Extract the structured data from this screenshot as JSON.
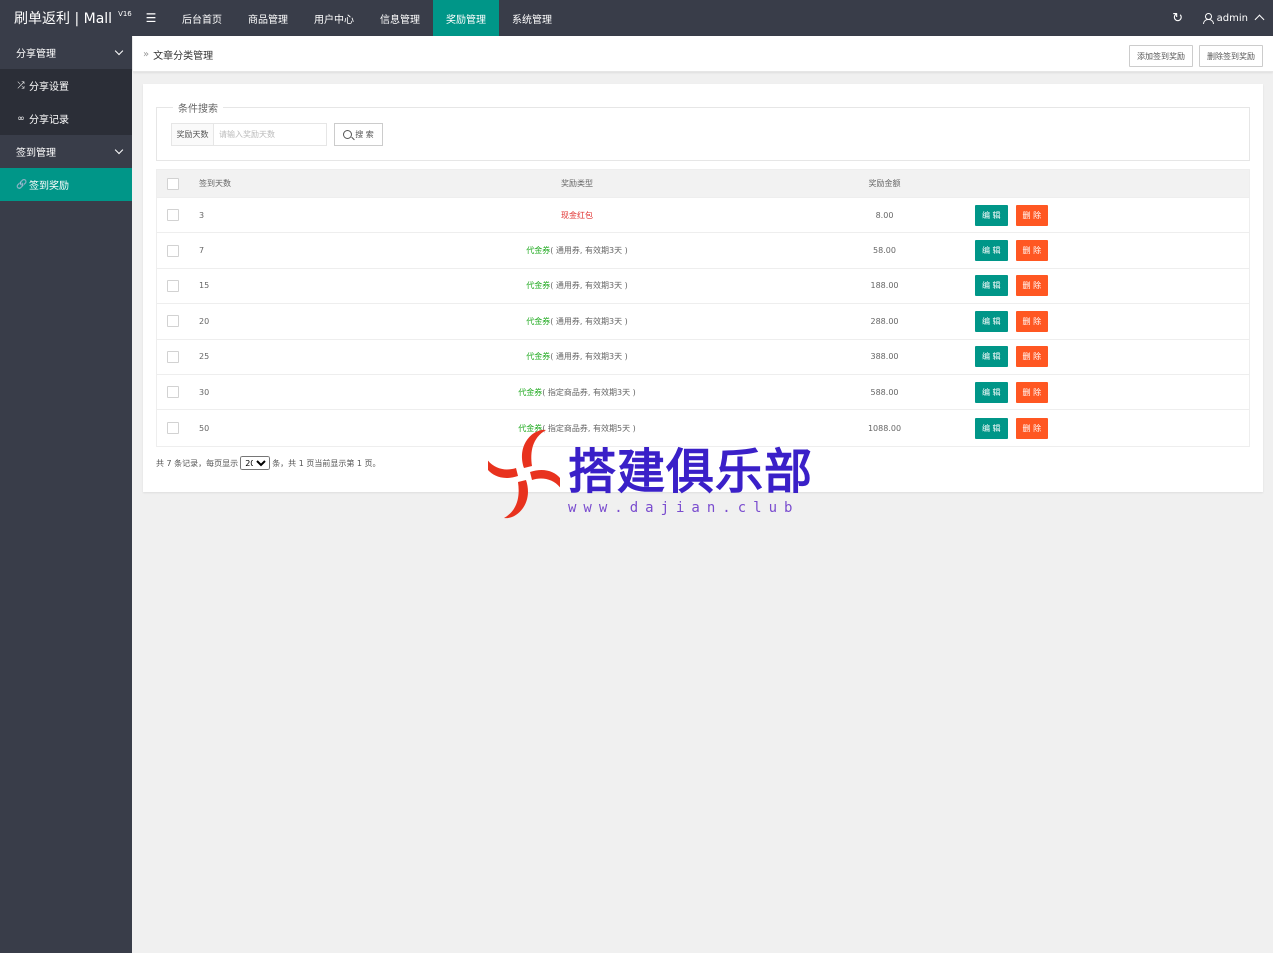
{
  "header": {
    "logo_text": "刷单返利 | Mall",
    "logo_version": "V16",
    "nav_toggle_icon": "menu-icon",
    "nav": [
      "后台首页",
      "商品管理",
      "用户中心",
      "信息管理",
      "奖励管理",
      "系统管理"
    ],
    "active_nav": "奖励管理",
    "user": "admin"
  },
  "sidebar": {
    "group1": "分享管理",
    "item_share_settings": "分享设置",
    "item_share_records": "分享记录",
    "group2": "签到管理",
    "item_sign_rewards": "签到奖励"
  },
  "breadcrumb": {
    "arrow": "»",
    "title": "文章分类管理",
    "add_button": "添加签到奖励",
    "delete_button": "删除签到奖励"
  },
  "search": {
    "legend": "条件搜索",
    "label": "奖励天数",
    "placeholder": "请输入奖励天数",
    "button": "搜 索"
  },
  "table": {
    "headers": {
      "days": "签到天数",
      "type": "奖励类型",
      "amount": "奖励金额"
    },
    "edit_label": "编 辑",
    "delete_label": "删 除",
    "rows": [
      {
        "days": "3",
        "type_main": "现金红包",
        "type_detail": "",
        "amount": "8.00"
      },
      {
        "days": "7",
        "type_main": "代金券",
        "type_detail": " ( 通用券,  有效期3天 )",
        "amount": "58.00"
      },
      {
        "days": "15",
        "type_main": "代金券",
        "type_detail": " ( 通用券,  有效期3天 )",
        "amount": "188.00"
      },
      {
        "days": "20",
        "type_main": "代金券",
        "type_detail": " ( 通用券,  有效期3天 )",
        "amount": "288.00"
      },
      {
        "days": "25",
        "type_main": "代金券",
        "type_detail": " ( 通用券,  有效期3天 )",
        "amount": "388.00"
      },
      {
        "days": "30",
        "type_main": "代金券",
        "type_detail": " ( 指定商品券,  有效期3天 )",
        "amount": "588.00"
      },
      {
        "days": "50",
        "type_main": "代金券",
        "type_detail": " ( 指定商品券,  有效期5天 )",
        "amount": "1088.00"
      }
    ]
  },
  "pager": {
    "prefix": "共 7 条记录，每页显示",
    "page_size": "20",
    "suffix": "条，共 1 页当前显示第 1 页。"
  },
  "watermark": {
    "text": "搭建俱乐部",
    "url": "www.dajian.club"
  },
  "colors": {
    "accent": "#009688",
    "danger": "#ff5722",
    "cash_red": "#e0312f",
    "coupon_green": "#1ba81b",
    "dark_bg": "#393d49"
  }
}
